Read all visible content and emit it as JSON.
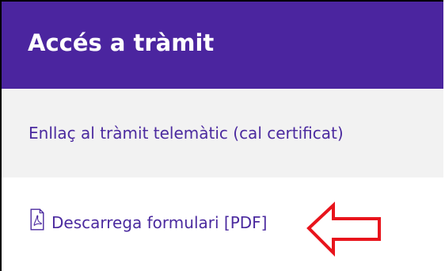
{
  "header": {
    "title": "Accés a tràmit"
  },
  "links": {
    "telematic_label": "Enllaç al tràmit telemàtic (cal certificat)",
    "download_label": "Descarrega formulari [PDF]",
    "download_icon": "pdf-file-icon"
  },
  "colors": {
    "header_bg": "#4b259f",
    "link_color": "#4b2a9f",
    "annotation_arrow": "#e8141c"
  },
  "annotation": {
    "icon": "left-arrow-outline-icon"
  }
}
